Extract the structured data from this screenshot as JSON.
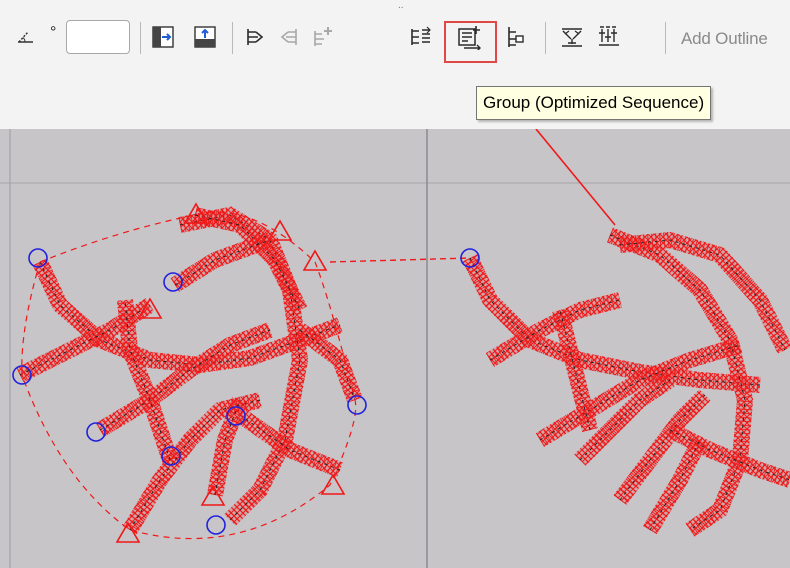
{
  "toolbar": {
    "angle_symbol": "°",
    "angle_value": "",
    "add_outline_label": "Add Outline",
    "grip_glyph": "..",
    "buttons": [
      {
        "id": "place-left",
        "icon": "panel-arrow-right-icon"
      },
      {
        "id": "place-top",
        "icon": "panel-arrow-up-icon"
      },
      {
        "id": "branch",
        "icon": "branch-icon"
      },
      {
        "id": "unbranch",
        "icon": "unbranch-icon",
        "disabled": true
      },
      {
        "id": "add-branch",
        "icon": "add-branch-icon",
        "disabled": true
      },
      {
        "id": "sequence",
        "icon": "sequence-icon"
      },
      {
        "id": "group-optimized-sequence",
        "icon": "group-optimized-sequence-icon",
        "highlighted": true
      },
      {
        "id": "tree",
        "icon": "tree-icon"
      },
      {
        "id": "convert",
        "icon": "convert-icon"
      },
      {
        "id": "align",
        "icon": "align-icon"
      }
    ]
  },
  "tooltip": {
    "text": "Group (Optimized Sequence)"
  },
  "colors": {
    "toolbar_bg": "#f3f3f3",
    "canvas_bg": "#c8c5c9",
    "stitch_red": "#f01818",
    "marker_blue": "#2222dd",
    "highlight_red": "#e04848",
    "icon_blue": "#1f5fd6",
    "icon_dark": "#2b2b2b"
  }
}
